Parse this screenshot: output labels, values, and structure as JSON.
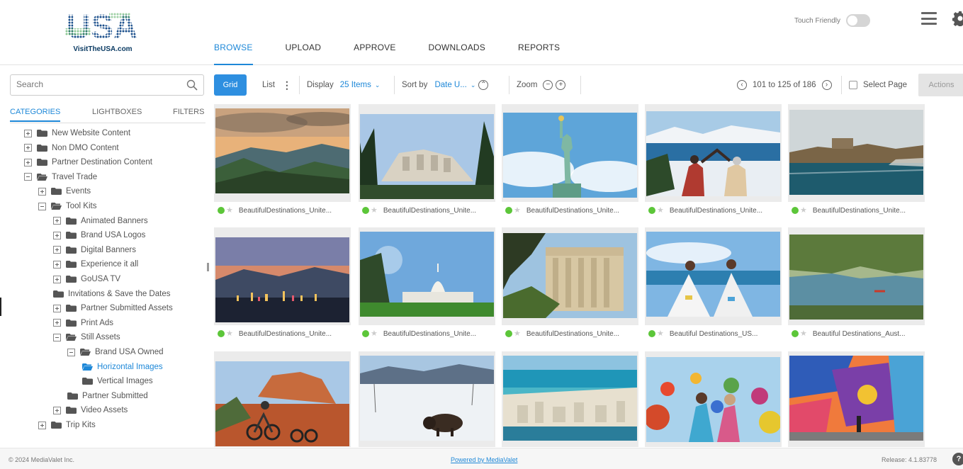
{
  "brand": {
    "logo_text": "USA",
    "logo_subtitle": "VisitTheUSA.com"
  },
  "nav": {
    "tabs": [
      "BROWSE",
      "UPLOAD",
      "APPROVE",
      "DOWNLOADS",
      "REPORTS"
    ],
    "active": "BROWSE"
  },
  "header": {
    "touch_label": "Touch Friendly",
    "touch_enabled": false
  },
  "search": {
    "placeholder": "Search"
  },
  "left_tabs": [
    "CATEGORIES",
    "LIGHTBOXES",
    "FILTERS"
  ],
  "tree": [
    {
      "label": "New Website Content",
      "toggle": "plus",
      "level": 0
    },
    {
      "label": "Non DMO Content",
      "toggle": "plus",
      "level": 0
    },
    {
      "label": "Partner Destination Content",
      "toggle": "plus",
      "level": 0
    },
    {
      "label": "Travel Trade",
      "toggle": "minus",
      "level": 0,
      "open": true
    },
    {
      "label": "Events",
      "toggle": "plus",
      "level": 1
    },
    {
      "label": "Tool Kits",
      "toggle": "minus",
      "level": 1,
      "open": true
    },
    {
      "label": "Animated Banners",
      "toggle": "plus",
      "level": 2
    },
    {
      "label": "Brand USA Logos",
      "toggle": "plus",
      "level": 2
    },
    {
      "label": "Digital Banners",
      "toggle": "plus",
      "level": 2
    },
    {
      "label": "Experience it all",
      "toggle": "plus",
      "level": 2
    },
    {
      "label": "GoUSA TV",
      "toggle": "plus",
      "level": 2
    },
    {
      "label": "Invitations & Save the Dates",
      "toggle": "none",
      "level": 2
    },
    {
      "label": "Partner Submitted Assets",
      "toggle": "plus",
      "level": 2
    },
    {
      "label": "Print Ads",
      "toggle": "plus",
      "level": 2
    },
    {
      "label": "Still Assets",
      "toggle": "minus",
      "level": 2,
      "open": true
    },
    {
      "label": "Brand USA Owned",
      "toggle": "minus",
      "level": 3,
      "open": true
    },
    {
      "label": "Horizontal Images",
      "toggle": "none",
      "level": 4,
      "open": true,
      "selected": true
    },
    {
      "label": "Vertical Images",
      "toggle": "none",
      "level": 4
    },
    {
      "label": "Partner Submitted",
      "toggle": "none",
      "level": 3
    },
    {
      "label": "Video Assets",
      "toggle": "plus",
      "level": 2
    },
    {
      "label": "Trip Kits",
      "toggle": "plus",
      "level": 1
    }
  ],
  "toolbar": {
    "grid_label": "Grid",
    "list_label": "List",
    "display_label": "Display",
    "display_value": "25 Items",
    "sortby_label": "Sort by",
    "sortby_value": "Date U...",
    "zoom_label": "Zoom",
    "pagination": "101 to 125 of 186",
    "select_page_label": "Select Page",
    "actions_label": "Actions"
  },
  "assets": [
    {
      "name": "BeautifulDestinations_Unite...",
      "status": "approved",
      "icon": "mountain-valley-sunset-photo"
    },
    {
      "name": "BeautifulDestinations_Unite...",
      "status": "approved",
      "icon": "mount-rushmore-photo"
    },
    {
      "name": "BeautifulDestinations_Unite...",
      "status": "approved",
      "icon": "statue-of-liberty-photo"
    },
    {
      "name": "BeautifulDestinations_Unite...",
      "status": "approved",
      "icon": "snowy-lake-couple-photo"
    },
    {
      "name": "BeautifulDestinations_Unite...",
      "status": "approved",
      "icon": "coastal-fortress-photo"
    },
    {
      "name": "BeautifulDestinations_Unite...",
      "status": "approved",
      "icon": "city-lights-dusk-photo"
    },
    {
      "name": "BeautifulDestinations_Unite...",
      "status": "approved",
      "icon": "us-capitol-photo"
    },
    {
      "name": "BeautifulDestinations_Unite...",
      "status": "approved",
      "icon": "columned-building-photo"
    },
    {
      "name": "Beautiful Destinations_US...",
      "status": "approved",
      "icon": "dancers-white-dresses-photo"
    },
    {
      "name": "Beautiful Destinations_Aust...",
      "status": "approved",
      "icon": "river-kayak-photo"
    },
    {
      "name": "",
      "status": "approved",
      "icon": "mountain-bikers-red-rocks-photo"
    },
    {
      "name": "",
      "status": "approved",
      "icon": "bison-snow-photo"
    },
    {
      "name": "",
      "status": "approved",
      "icon": "miami-beach-aerial-photo"
    },
    {
      "name": "",
      "status": "approved",
      "icon": "hot-air-balloons-photo"
    },
    {
      "name": "",
      "status": "approved",
      "icon": "mural-street-photo"
    }
  ],
  "footer": {
    "copyright": "© 2024 MediaValet Inc.",
    "powered_by": "Powered by MediaValet",
    "release": "Release: 4.1.83778",
    "help": "?"
  },
  "colors": {
    "accent": "#1e88d8",
    "approved_dot": "#5cc639",
    "brand_blue": "#0b3b63"
  },
  "icons": [
    "search-icon",
    "hamburger-menu-icon",
    "gear-icon",
    "folder-icon",
    "star-icon",
    "help-icon"
  ]
}
